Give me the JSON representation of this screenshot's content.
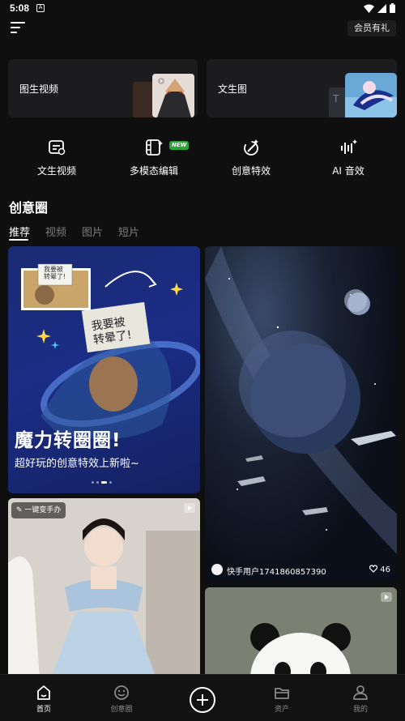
{
  "status_bar": {
    "time": "5:08",
    "a_icon": "A"
  },
  "header": {
    "vip_label": "会员有礼"
  },
  "cards": [
    {
      "label": "图生视频"
    },
    {
      "label": "文生图"
    }
  ],
  "quick_actions": [
    {
      "label": "文生视频",
      "icon": "text-video-icon"
    },
    {
      "label": "多模态编辑",
      "icon": "multimodal-edit-icon",
      "badge": "NEW"
    },
    {
      "label": "创意特效",
      "icon": "magic-effect-icon"
    },
    {
      "label": "AI 音效",
      "icon": "audio-wave-icon"
    }
  ],
  "section": {
    "title": "创意圈"
  },
  "tabs": [
    {
      "label": "推荐",
      "active": true
    },
    {
      "label": "视频"
    },
    {
      "label": "图片"
    },
    {
      "label": "短片"
    }
  ],
  "feed": {
    "promo": {
      "sign_text_small": "我要被\n转晕了!",
      "sign_text_big": "我要被\n转晕了!",
      "title": "魔力转圈圈!",
      "subtitle": "超好玩的创意特效上新啦~",
      "dots_count": 4,
      "active_dot": 2
    },
    "space_post": {
      "user": "快手用户1741860857390",
      "likes": "46"
    },
    "dress_post": {
      "tag": "一键变手办"
    }
  },
  "bottom_nav": [
    {
      "label": "首页",
      "active": true
    },
    {
      "label": "创意圈"
    },
    {
      "label": ""
    },
    {
      "label": "资产"
    },
    {
      "label": "我的"
    }
  ]
}
